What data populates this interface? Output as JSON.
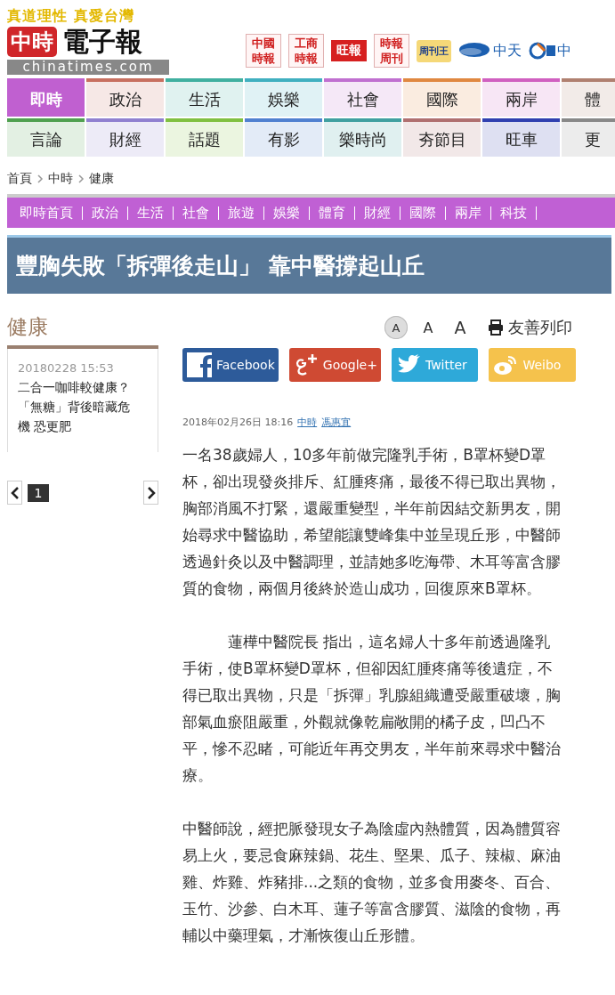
{
  "header": {
    "tagline": "真道理性 真愛台灣",
    "logo_mark": "中時",
    "logo_text": "電子報",
    "domain": "chinatimes.com",
    "partners": [
      {
        "label": "中國時報",
        "kind": "grid"
      },
      {
        "label": "工商時報",
        "kind": "grid"
      },
      {
        "label": "旺報",
        "kind": "block"
      },
      {
        "label": "時報周刊",
        "kind": "grid"
      },
      {
        "label": "周刊王",
        "kind": "gold"
      },
      {
        "label": "中天",
        "kind": "cti"
      },
      {
        "label": "中",
        "kind": "ctv"
      }
    ]
  },
  "main_nav": [
    [
      {
        "label": "即時",
        "color": "#c060d0",
        "selected": true
      },
      {
        "label": "政治",
        "color": "#c87060",
        "selected": false
      },
      {
        "label": "生活",
        "color": "#40b0a0",
        "selected": false
      },
      {
        "label": "娛樂",
        "color": "#40b0c0",
        "selected": false
      },
      {
        "label": "社會",
        "color": "#c070d0",
        "selected": false
      },
      {
        "label": "國際",
        "color": "#e08840",
        "selected": false
      },
      {
        "label": "兩岸",
        "color": "#d060c0",
        "selected": false
      },
      {
        "label": "體",
        "color": "#b08070",
        "selected": false
      }
    ],
    [
      {
        "label": "言論",
        "color": "#50a050",
        "selected": false
      },
      {
        "label": "財經",
        "color": "#9080d0",
        "selected": false
      },
      {
        "label": "話題",
        "color": "#80c040",
        "selected": false
      },
      {
        "label": "有影",
        "color": "#5080d0",
        "selected": false
      },
      {
        "label": "樂時尚",
        "color": "#40a0a0",
        "selected": false
      },
      {
        "label": "夯節目",
        "color": "#b07070",
        "selected": false
      },
      {
        "label": "旺車",
        "color": "#3040b0",
        "selected": false
      },
      {
        "label": "更",
        "color": "#888888",
        "selected": false
      }
    ]
  ],
  "breadcrumb": [
    "首頁",
    "中時",
    "健康"
  ],
  "sub_nav": [
    "即時首頁",
    "政治",
    "生活",
    "社會",
    "旅遊",
    "娛樂",
    "體育",
    "財經",
    "國際",
    "兩岸",
    "科技"
  ],
  "title": "豐胸失敗「拆彈後走山」 靠中醫撐起山丘",
  "sidebar": {
    "heading": "健康",
    "items": [
      {
        "date": "20180228 15:53",
        "title": "二合一咖啡較健康？「無糖」背後暗藏危機 恐更肥"
      }
    ],
    "pager": {
      "page": "1"
    }
  },
  "tools": {
    "font_sizes": [
      {
        "label": "A",
        "selected": true
      },
      {
        "label": "A",
        "selected": false
      },
      {
        "label": "A",
        "selected": false
      }
    ],
    "print": "友善列印"
  },
  "share": [
    {
      "label": "Facebook",
      "kind": "facebook"
    },
    {
      "label": "Google+",
      "kind": "google"
    },
    {
      "label": "Twitter",
      "kind": "twitter"
    },
    {
      "label": "Weibo",
      "kind": "weibo"
    }
  ],
  "meta": {
    "datetime": "2018年02月26日 18:16",
    "links": [
      "中時",
      "馮惠宜"
    ]
  },
  "paragraphs": [
    "一名38歲婦人，10多年前做完隆乳手術，B罩杯變D罩杯，卻出現發炎排斥、紅腫疼痛，最後不得已取出異物，胸部消風不打緊，還嚴重變型，半年前因結交新男友，開始尋求中醫協助，希望能讓雙峰集中並呈現丘形，中醫師透過針灸以及中醫調理，並請她多吃海帶、木耳等富含膠質的食物，兩個月後終於造山成功，回復原來B罩杯。",
    "　　　蓮樺中醫院長 指出，這名婦人十多年前透過隆乳手術，使B罩杯變D罩杯，但卻因紅腫疼痛等後遺症，不得已取出異物，只是「拆彈」乳腺組織遭受嚴重破壞，胸部氣血瘀阻嚴重，外觀就像乾扁敞開的橘子皮，凹凸不平，慘不忍睹，可能近年再交男友，半年前來尋求中醫治療。",
    "中醫師說，經把脈發現女子為陰虛內熱體質，因為體質容易上火，要忌食麻辣鍋、花生、堅果、瓜子、辣椒、麻油雞、炸雞、炸豬排...之類的食物，並多食用麥冬、百合、玉竹、沙參、白木耳、蓮子等富含膠質、滋陰的食物，再輔以中藥理氣，才漸恢復山丘形體。"
  ]
}
